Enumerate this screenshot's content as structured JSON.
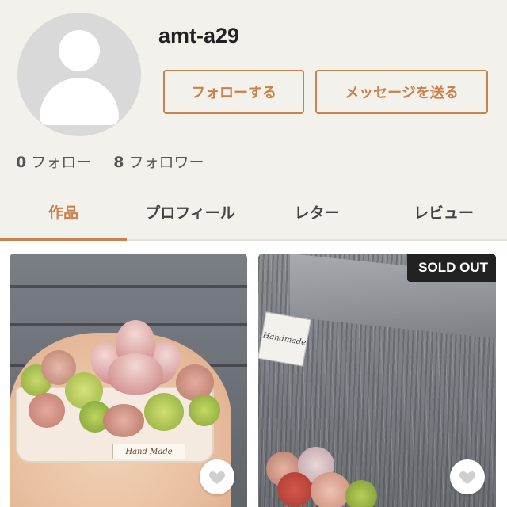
{
  "profile": {
    "username": "amt-a29",
    "follow_button": "フォローする",
    "message_button": "メッセージを送る",
    "following_count": "0",
    "following_label": "フォロー",
    "followers_count": "8",
    "followers_label": "フォロワー"
  },
  "tabs": [
    {
      "label": "作品",
      "active": true
    },
    {
      "label": "プロフィール",
      "active": false
    },
    {
      "label": "レター",
      "active": false
    },
    {
      "label": "レビュー",
      "active": false
    }
  ],
  "items": [
    {
      "sold_out": false,
      "pot_label": "Hand Made",
      "icon": "heart-icon"
    },
    {
      "sold_out": true,
      "badge": "SOLD OUT",
      "tag_label": "Handmade",
      "icon": "heart-icon"
    }
  ],
  "colors": {
    "accent": "#c9824d",
    "background": "#f3f1ec",
    "badge": "#222222"
  }
}
